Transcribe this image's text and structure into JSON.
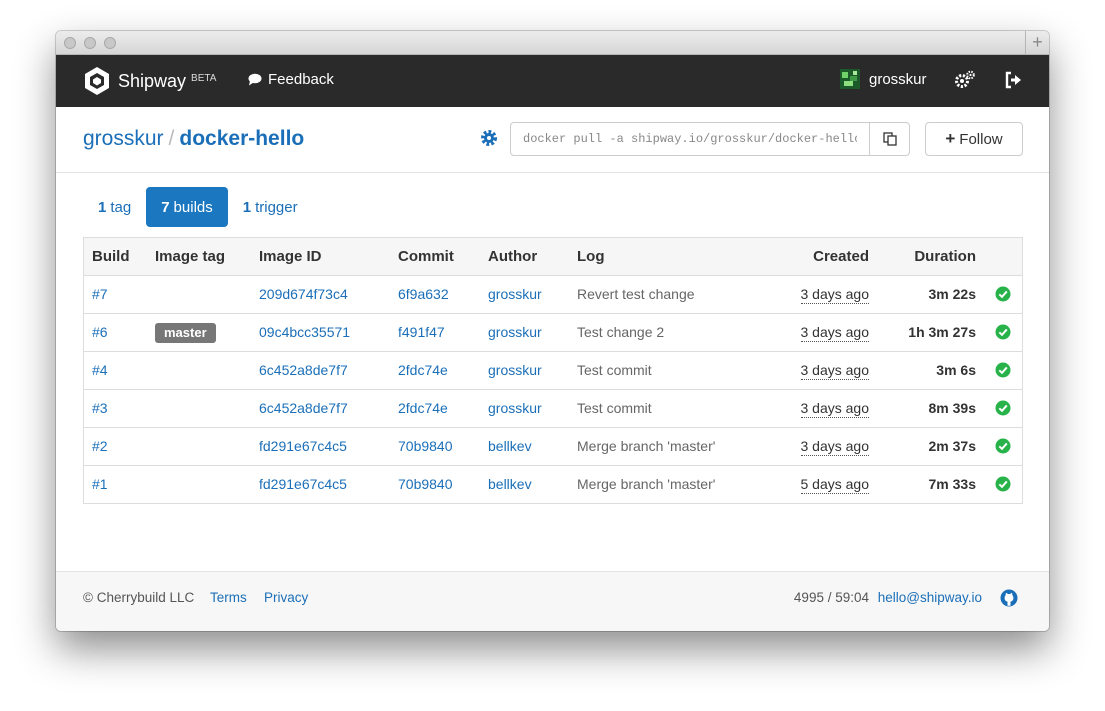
{
  "nav": {
    "brand": "Shipway",
    "beta": "BETA",
    "feedback": "Feedback",
    "username": "grosskur"
  },
  "header": {
    "owner": "grosskur",
    "separator": "/",
    "repo": "docker-hello",
    "pull_command": "docker pull -a shipway.io/grosskur/docker-hello",
    "follow": "Follow"
  },
  "tabs": [
    {
      "count": "1",
      "label": "tag",
      "active": false
    },
    {
      "count": "7",
      "label": "builds",
      "active": true
    },
    {
      "count": "1",
      "label": "trigger",
      "active": false
    }
  ],
  "table": {
    "headers": {
      "build": "Build",
      "image_tag": "Image tag",
      "image_id": "Image ID",
      "commit": "Commit",
      "author": "Author",
      "log": "Log",
      "created": "Created",
      "duration": "Duration"
    },
    "rows": [
      {
        "build": "#7",
        "tag": "",
        "image_id": "209d674f73c4",
        "commit": "6f9a632",
        "author": "grosskur",
        "log": "Revert test change",
        "created": "3 days ago",
        "duration": "3m 22s",
        "status": "success"
      },
      {
        "build": "#6",
        "tag": "master",
        "image_id": "09c4bcc35571",
        "commit": "f491f47",
        "author": "grosskur",
        "log": "Test change 2",
        "created": "3 days ago",
        "duration": "1h 3m 27s",
        "status": "success"
      },
      {
        "build": "#4",
        "tag": "",
        "image_id": "6c452a8de7f7",
        "commit": "2fdc74e",
        "author": "grosskur",
        "log": "Test commit",
        "created": "3 days ago",
        "duration": "3m 6s",
        "status": "success"
      },
      {
        "build": "#3",
        "tag": "",
        "image_id": "6c452a8de7f7",
        "commit": "2fdc74e",
        "author": "grosskur",
        "log": "Test commit",
        "created": "3 days ago",
        "duration": "8m 39s",
        "status": "success"
      },
      {
        "build": "#2",
        "tag": "",
        "image_id": "fd291e67c4c5",
        "commit": "70b9840",
        "author": "bellkev",
        "log": "Merge branch 'master'",
        "created": "3 days ago",
        "duration": "2m 37s",
        "status": "success"
      },
      {
        "build": "#1",
        "tag": "",
        "image_id": "fd291e67c4c5",
        "commit": "70b9840",
        "author": "bellkev",
        "log": "Merge branch 'master'",
        "created": "5 days ago",
        "duration": "7m 33s",
        "status": "success"
      }
    ]
  },
  "footer": {
    "copyright": "© Cherrybuild LLC",
    "terms": "Terms",
    "privacy": "Privacy",
    "stats": "4995 / 59:04",
    "email": "hello@shipway.io"
  },
  "colors": {
    "navbar": "#2a2a2a",
    "link": "#1b6fb8",
    "active_tab": "#1b78c0",
    "success": "#27b24a",
    "badge": "#777777"
  },
  "icons": {
    "brand": "shipway-logo-icon",
    "feedback": "chat-bubble-icon",
    "settings": "gears-icon",
    "signout": "sign-out-icon",
    "repo_settings": "gear-icon",
    "copy": "copy-icon",
    "status": "check-circle-icon",
    "github": "github-icon"
  }
}
